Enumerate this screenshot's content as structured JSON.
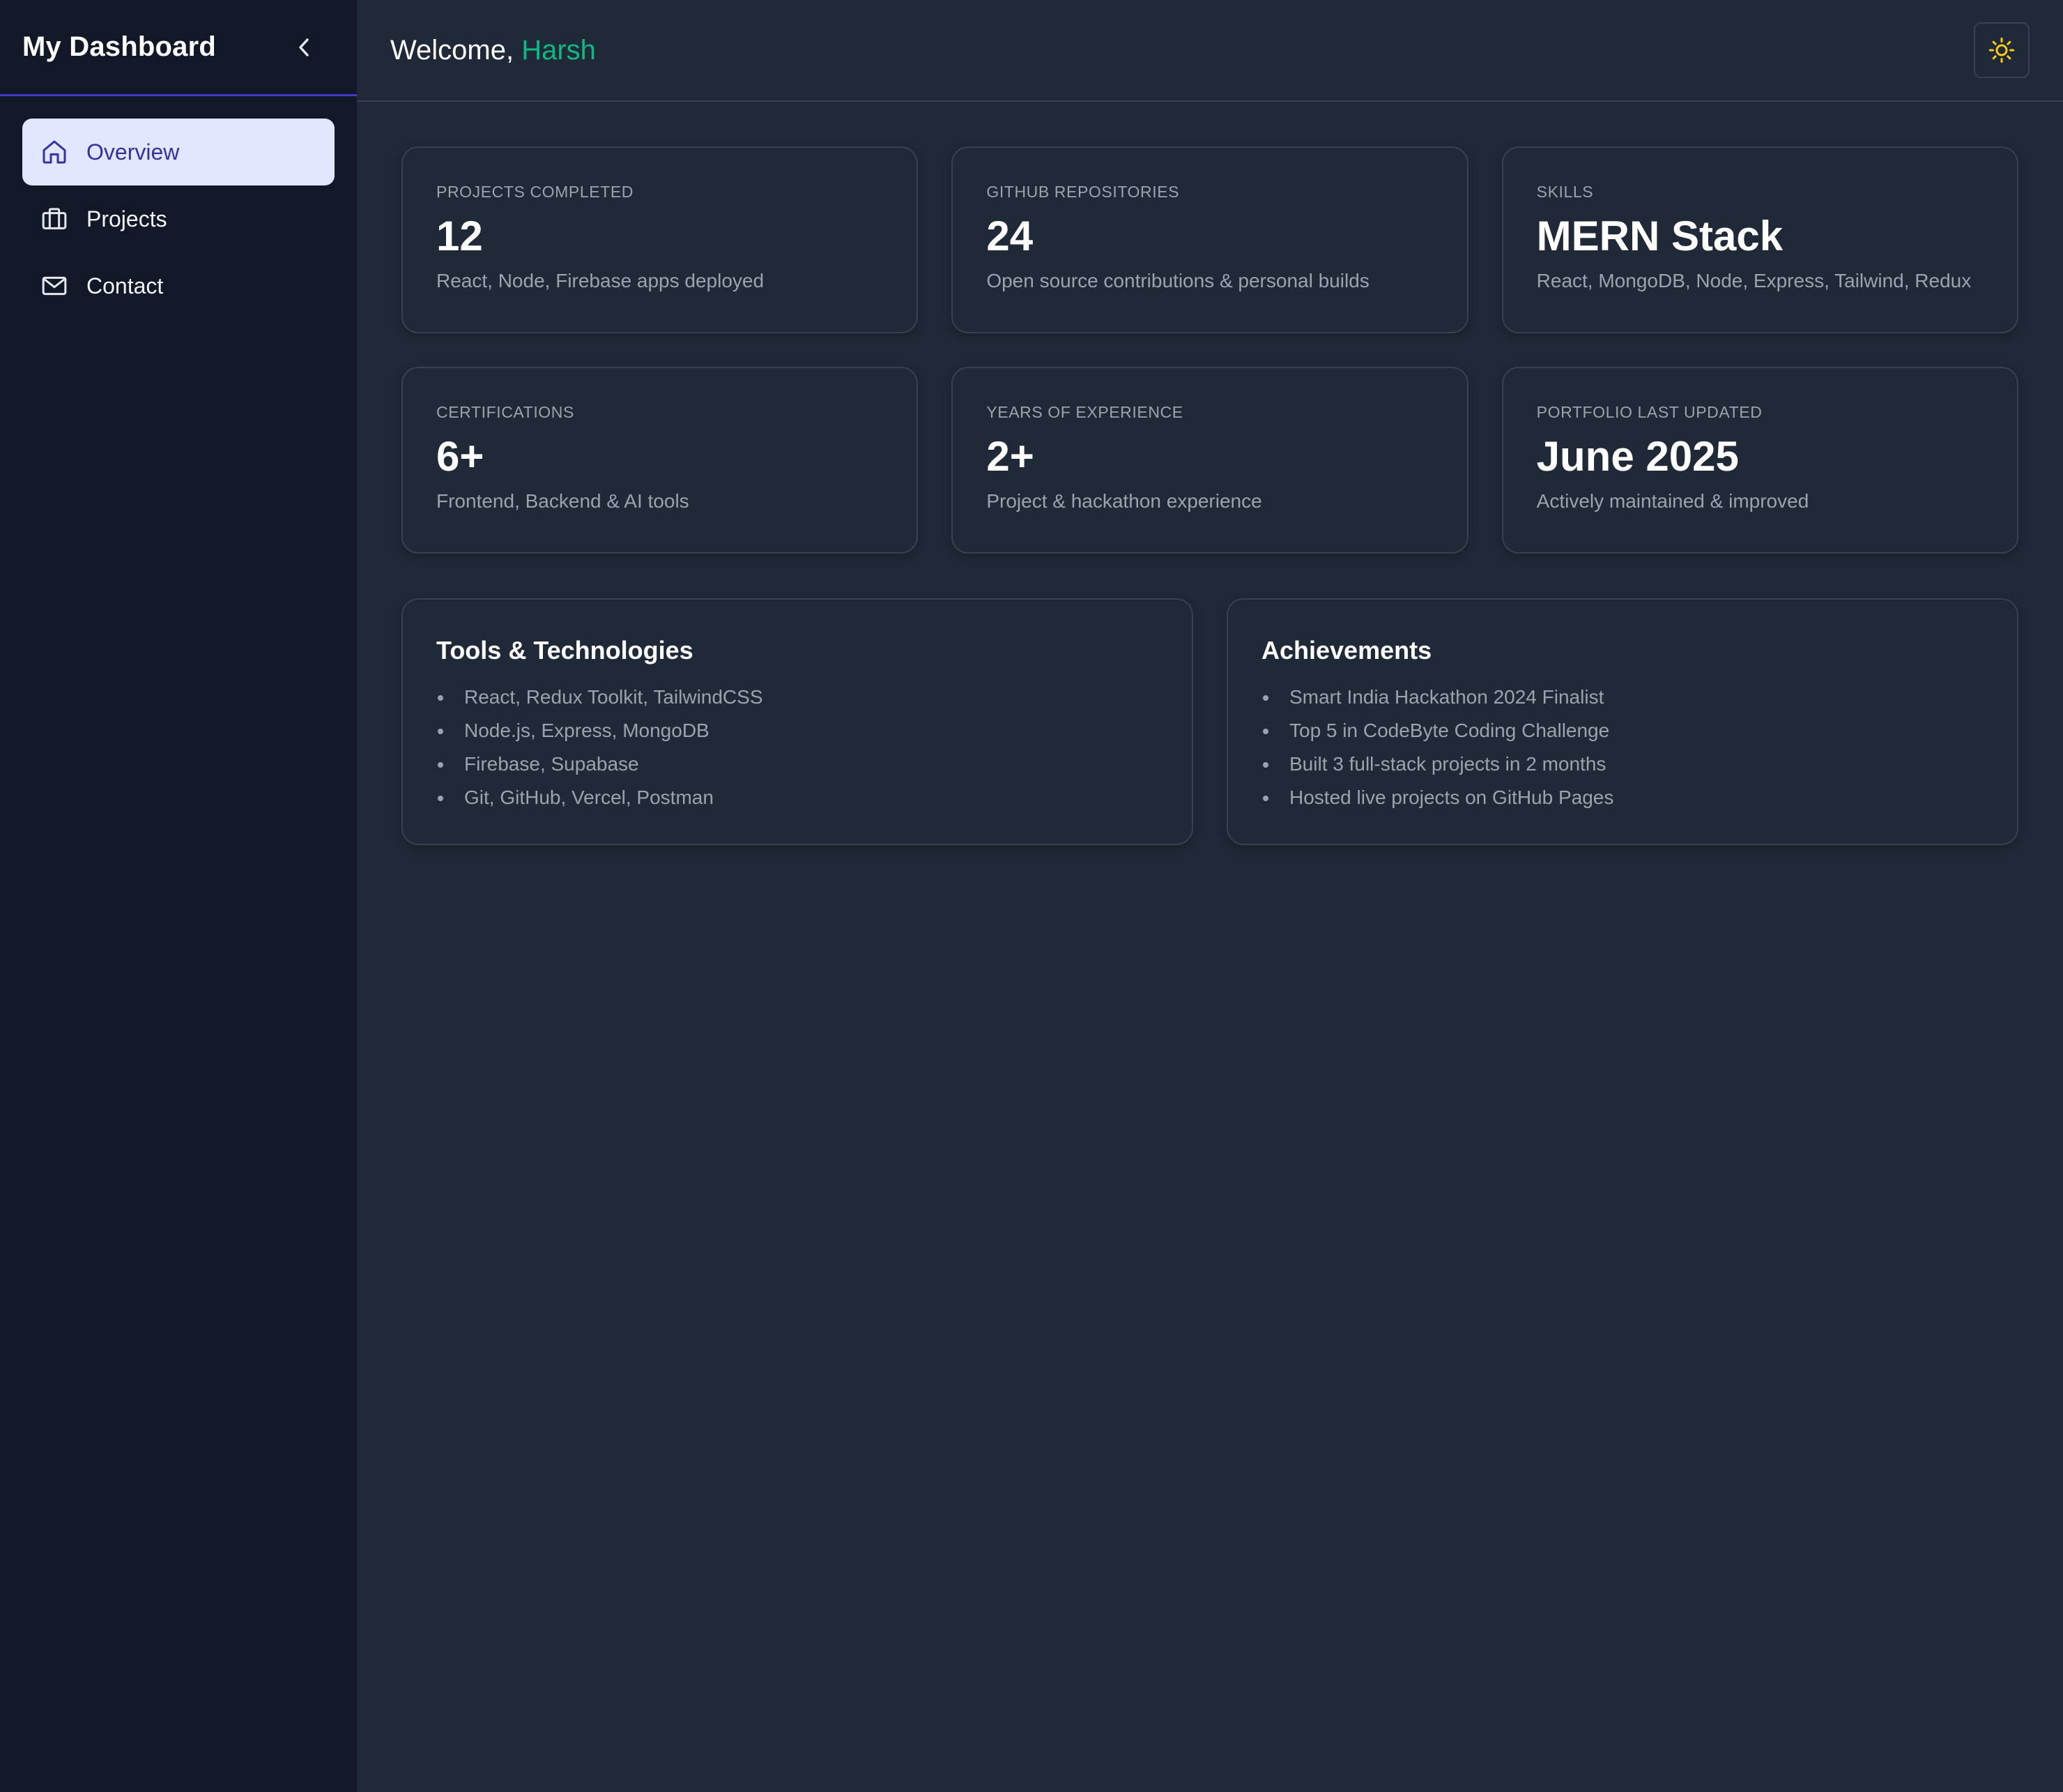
{
  "sidebar": {
    "title": "My Dashboard",
    "items": [
      {
        "label": "Overview",
        "icon": "home-icon",
        "active": true
      },
      {
        "label": "Projects",
        "icon": "briefcase-icon",
        "active": false
      },
      {
        "label": "Contact",
        "icon": "mail-icon",
        "active": false
      }
    ]
  },
  "header": {
    "greeting": "Welcome,",
    "user_name": "Harsh",
    "theme_icon": "sun-icon"
  },
  "stats": [
    {
      "label": "PROJECTS COMPLETED",
      "value": "12",
      "description": "React, Node, Firebase apps deployed"
    },
    {
      "label": "GITHUB REPOSITORIES",
      "value": "24",
      "description": "Open source contributions & personal builds"
    },
    {
      "label": "SKILLS",
      "value": "MERN Stack",
      "description": "React, MongoDB, Node, Express, Tailwind, Redux"
    },
    {
      "label": "CERTIFICATIONS",
      "value": "6+",
      "description": "Frontend, Backend & AI tools"
    },
    {
      "label": "YEARS OF EXPERIENCE",
      "value": "2+",
      "description": "Project & hackathon experience"
    },
    {
      "label": "PORTFOLIO LAST UPDATED",
      "value": "June 2025",
      "description": "Actively maintained & improved"
    }
  ],
  "tools": {
    "title": "Tools & Technologies",
    "items": [
      "React, Redux Toolkit, TailwindCSS",
      "Node.js, Express, MongoDB",
      "Firebase, Supabase",
      "Git, GitHub, Vercel, Postman"
    ]
  },
  "achievements": {
    "title": "Achievements",
    "items": [
      "Smart India Hackathon 2024 Finalist",
      "Top 5 in CodeByte Coding Challenge",
      "Built 3 full-stack projects in 2 months",
      "Hosted live projects on GitHub Pages"
    ]
  },
  "colors": {
    "accent": "#10b981",
    "sidebar_bg": "#111827",
    "main_bg": "#1f2937",
    "active_nav_bg": "#e0e7ff",
    "active_nav_text": "#3730a3",
    "sun": "#facc15"
  }
}
